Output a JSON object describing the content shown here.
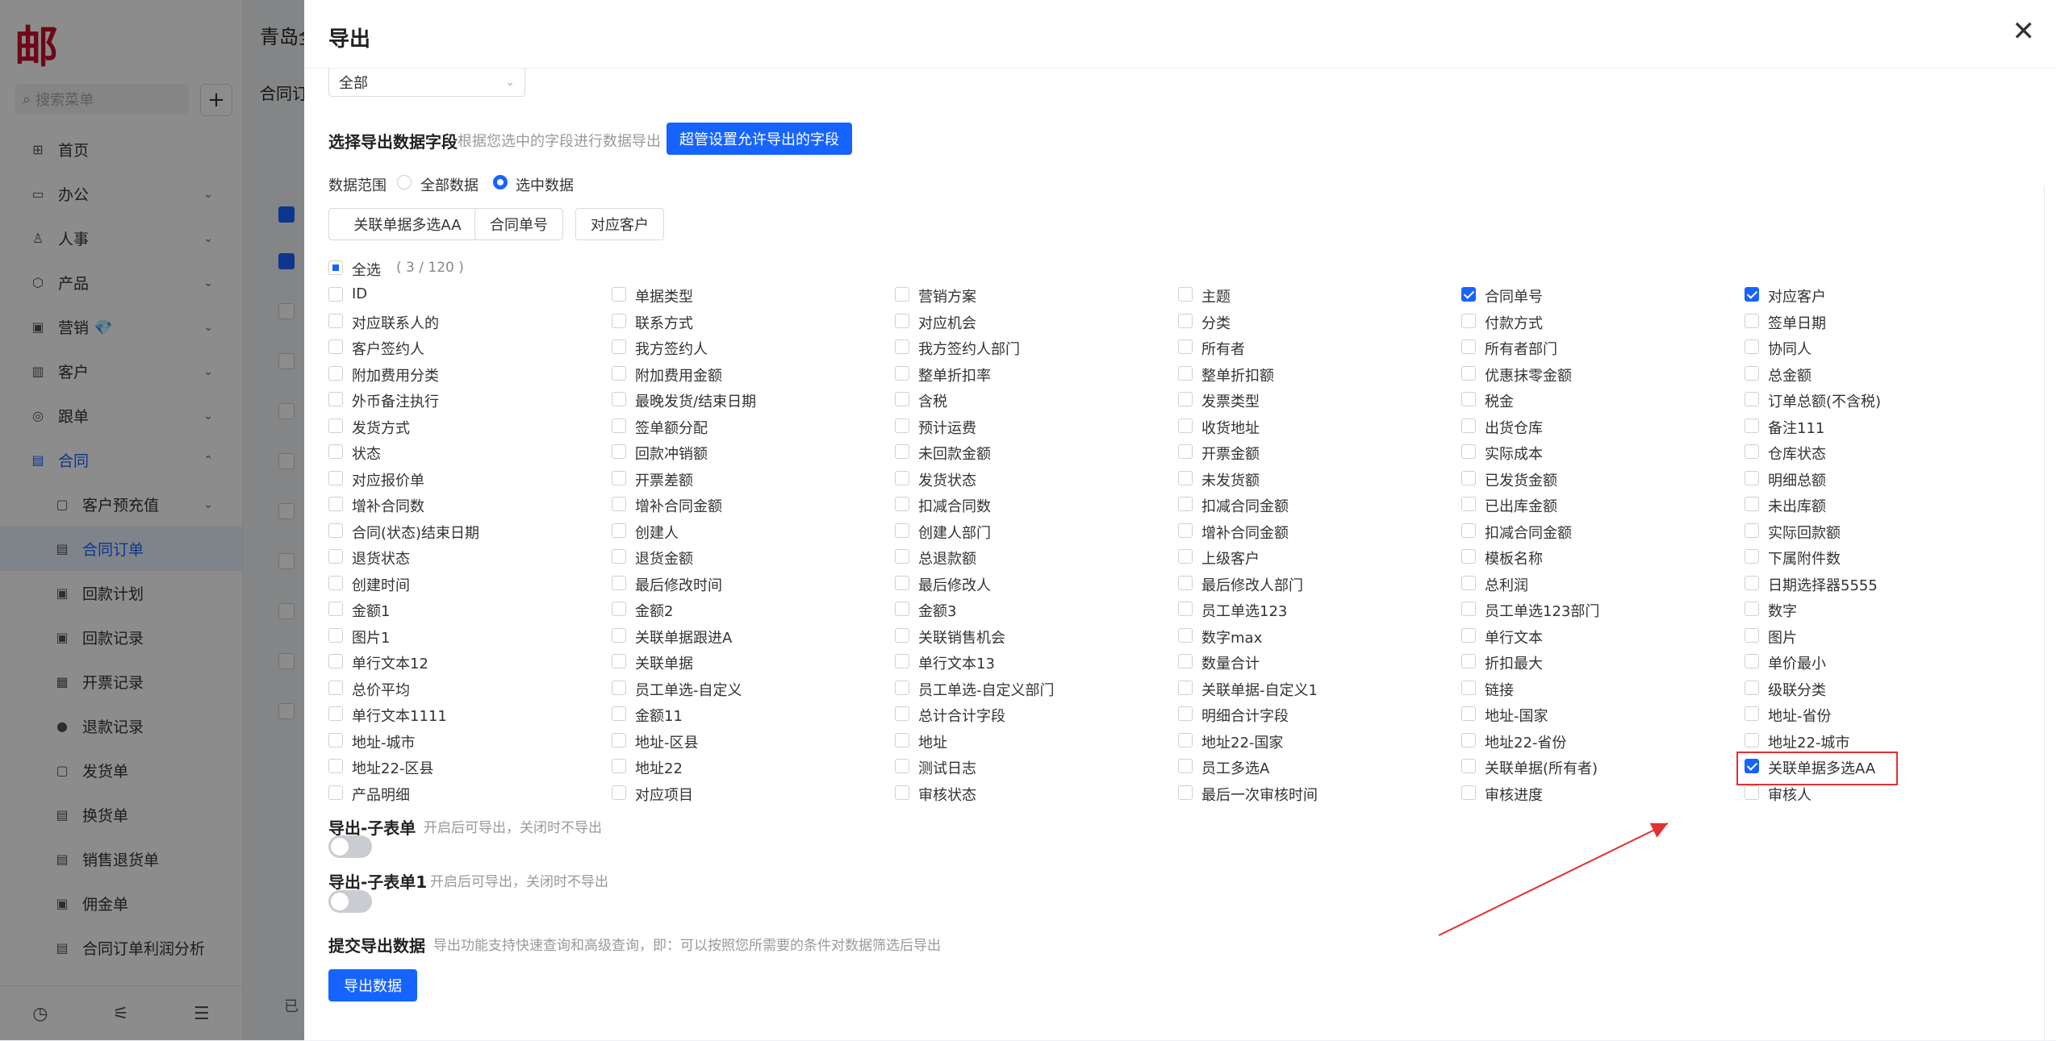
{
  "app": {
    "logo_text": "邮",
    "title": "青岛全"
  },
  "sidebar": {
    "search_placeholder": "搜索菜单",
    "items": [
      {
        "label": "首页",
        "icon": "home-icon",
        "glyph": "⊞",
        "chevron": ""
      },
      {
        "label": "办公",
        "icon": "office-icon",
        "glyph": "▭",
        "chevron": "⌄"
      },
      {
        "label": "人事",
        "icon": "person-icon",
        "glyph": "♙",
        "chevron": "⌄"
      },
      {
        "label": "产品",
        "icon": "product-icon",
        "glyph": "⬡",
        "chevron": "⌄"
      },
      {
        "label": "营销 💎",
        "icon": "marketing-icon",
        "glyph": "▣",
        "chevron": "⌄"
      },
      {
        "label": "客户",
        "icon": "customer-icon",
        "glyph": "▥",
        "chevron": "⌄"
      },
      {
        "label": "跟单",
        "icon": "follow-icon",
        "glyph": "◎",
        "chevron": "⌄"
      },
      {
        "label": "合同",
        "icon": "contract-icon",
        "glyph": "▤",
        "chevron": "⌃"
      }
    ],
    "sub_items": [
      {
        "label": "客户预充值",
        "icon": "prepay-icon",
        "glyph": "▢",
        "chevron": "⌄"
      },
      {
        "label": "合同订单",
        "icon": "order-icon",
        "glyph": "▤",
        "chevron": ""
      },
      {
        "label": "回款计划",
        "icon": "plan-icon",
        "glyph": "▣",
        "chevron": ""
      },
      {
        "label": "回款记录",
        "icon": "record-icon",
        "glyph": "▣",
        "chevron": ""
      },
      {
        "label": "开票记录",
        "icon": "invoice-icon",
        "glyph": "▦",
        "chevron": ""
      },
      {
        "label": "退款记录",
        "icon": "refund-icon",
        "glyph": "●",
        "chevron": ""
      },
      {
        "label": "发货单",
        "icon": "ship-icon",
        "glyph": "▢",
        "chevron": ""
      },
      {
        "label": "换货单",
        "icon": "exchange-icon",
        "glyph": "▤",
        "chevron": ""
      },
      {
        "label": "销售退货单",
        "icon": "return-icon",
        "glyph": "▤",
        "chevron": ""
      },
      {
        "label": "佣金单",
        "icon": "commission-icon",
        "glyph": "▣",
        "chevron": ""
      },
      {
        "label": "合同订单利润分析",
        "icon": "profit-icon",
        "glyph": "▤",
        "chevron": ""
      }
    ],
    "bottom_icons": [
      "history-icon",
      "filter-icon",
      "collapse-icon"
    ]
  },
  "main": {
    "tab": "合同订",
    "footer": "已"
  },
  "drawer": {
    "title": "导出",
    "select_value": "全部",
    "fields_section": {
      "title": "选择导出数据字段",
      "desc": "根据您选中的字段进行数据导出",
      "admin_button": "超管设置允许导出的字段"
    },
    "range": {
      "label": "数据范围",
      "option_all": "全部数据",
      "option_selected": "选中数据"
    },
    "selected_tags": [
      "关联单据多选AA",
      "合同单号",
      "对应客户"
    ],
    "select_all": {
      "label": "全选",
      "count": "( 3 / 120 )"
    },
    "fields": [
      [
        "ID",
        "单据类型",
        "营销方案",
        "主题",
        "合同单号",
        "对应客户"
      ],
      [
        "对应联系人的",
        "联系方式",
        "对应机会",
        "分类",
        "付款方式",
        "签单日期"
      ],
      [
        "客户签约人",
        "我方签约人",
        "我方签约人部门",
        "所有者",
        "所有者部门",
        "协同人"
      ],
      [
        "附加费用分类",
        "附加费用金额",
        "整单折扣率",
        "整单折扣额",
        "优惠抹零金额",
        "总金额"
      ],
      [
        "外币备注执行",
        "最晚发货/结束日期",
        "含税",
        "发票类型",
        "税金",
        "订单总额(不含税)"
      ],
      [
        "发货方式",
        "签单额分配",
        "预计运费",
        "收货地址",
        "出货仓库",
        "备注111"
      ],
      [
        "状态",
        "回款冲销额",
        "未回款金额",
        "开票金额",
        "实际成本",
        "仓库状态"
      ],
      [
        "对应报价单",
        "开票差额",
        "发货状态",
        "未发货额",
        "已发货金额",
        "明细总额"
      ],
      [
        "增补合同数",
        "增补合同金额",
        "扣减合同数",
        "扣减合同金额",
        "已出库金额",
        "未出库额"
      ],
      [
        "合同(状态)结束日期",
        "创建人",
        "创建人部门",
        "增补合同金额",
        "扣减合同金额",
        "实际回款额"
      ],
      [
        "退货状态",
        "退货金额",
        "总退款额",
        "上级客户",
        "模板名称",
        "下属附件数"
      ],
      [
        "创建时间",
        "最后修改时间",
        "最后修改人",
        "最后修改人部门",
        "总利润",
        "日期选择器5555"
      ],
      [
        "金额1",
        "金额2",
        "金额3",
        "员工单选123",
        "员工单选123部门",
        "数字"
      ],
      [
        "图片1",
        "关联单据跟进A",
        "关联销售机会",
        "数字max",
        "单行文本",
        "图片"
      ],
      [
        "单行文本12",
        "关联单据",
        "单行文本13",
        "数量合计",
        "折扣最大",
        "单价最小"
      ],
      [
        "总价平均",
        "员工单选-自定义",
        "员工单选-自定义部门",
        "关联单据-自定义1",
        "链接",
        "级联分类"
      ],
      [
        "单行文本1111",
        "金额11",
        "总计合计字段",
        "明细合计字段",
        "地址-国家",
        "地址-省份"
      ],
      [
        "地址-城市",
        "地址-区县",
        "地址",
        "地址22-国家",
        "地址22-省份",
        "地址22-城市"
      ],
      [
        "地址22-区县",
        "地址22",
        "测试日志",
        "员工多选A",
        "关联单据(所有者)",
        "关联单据多选AA"
      ],
      [
        "产品明细",
        "对应项目",
        "审核状态",
        "最后一次审核时间",
        "审核进度",
        "审核人"
      ]
    ],
    "checked": [
      "合同单号",
      "对应客户",
      "关联单据多选AA"
    ],
    "subtable1": {
      "title": "导出-子表单",
      "desc": "开启后可导出，关闭时不导出"
    },
    "subtable2": {
      "title": "导出-子表单1",
      "desc": "开启后可导出，关闭时不导出"
    },
    "submit": {
      "title": "提交导出数据",
      "desc": "导出功能支持快速查询和高级查询，即：可以按照您所需要的条件对数据筛选后导出",
      "button": "导出数据"
    }
  }
}
